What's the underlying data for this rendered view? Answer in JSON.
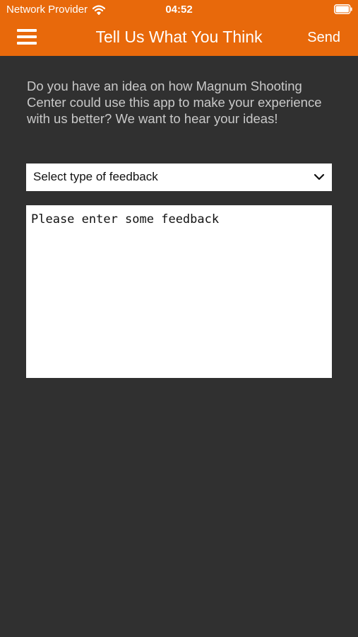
{
  "status_bar": {
    "carrier": "Network Provider",
    "time": "04:52",
    "wifi_icon": "wifi-icon",
    "battery_icon": "battery-icon"
  },
  "header": {
    "menu_icon": "hamburger-menu-icon",
    "title": "Tell Us What You Think",
    "send_label": "Send",
    "background_color": "#E8690B"
  },
  "main": {
    "intro_text": "Do you have an idea on how Magnum Shooting Center could use this app to make your experience with us better? We want to hear your ideas!",
    "feedback_type": {
      "selected_label": "Select type of feedback",
      "icon": "chevron-down-icon"
    },
    "feedback_text": {
      "value": "",
      "placeholder": "Please enter some feedback"
    },
    "background_color": "#303030"
  }
}
